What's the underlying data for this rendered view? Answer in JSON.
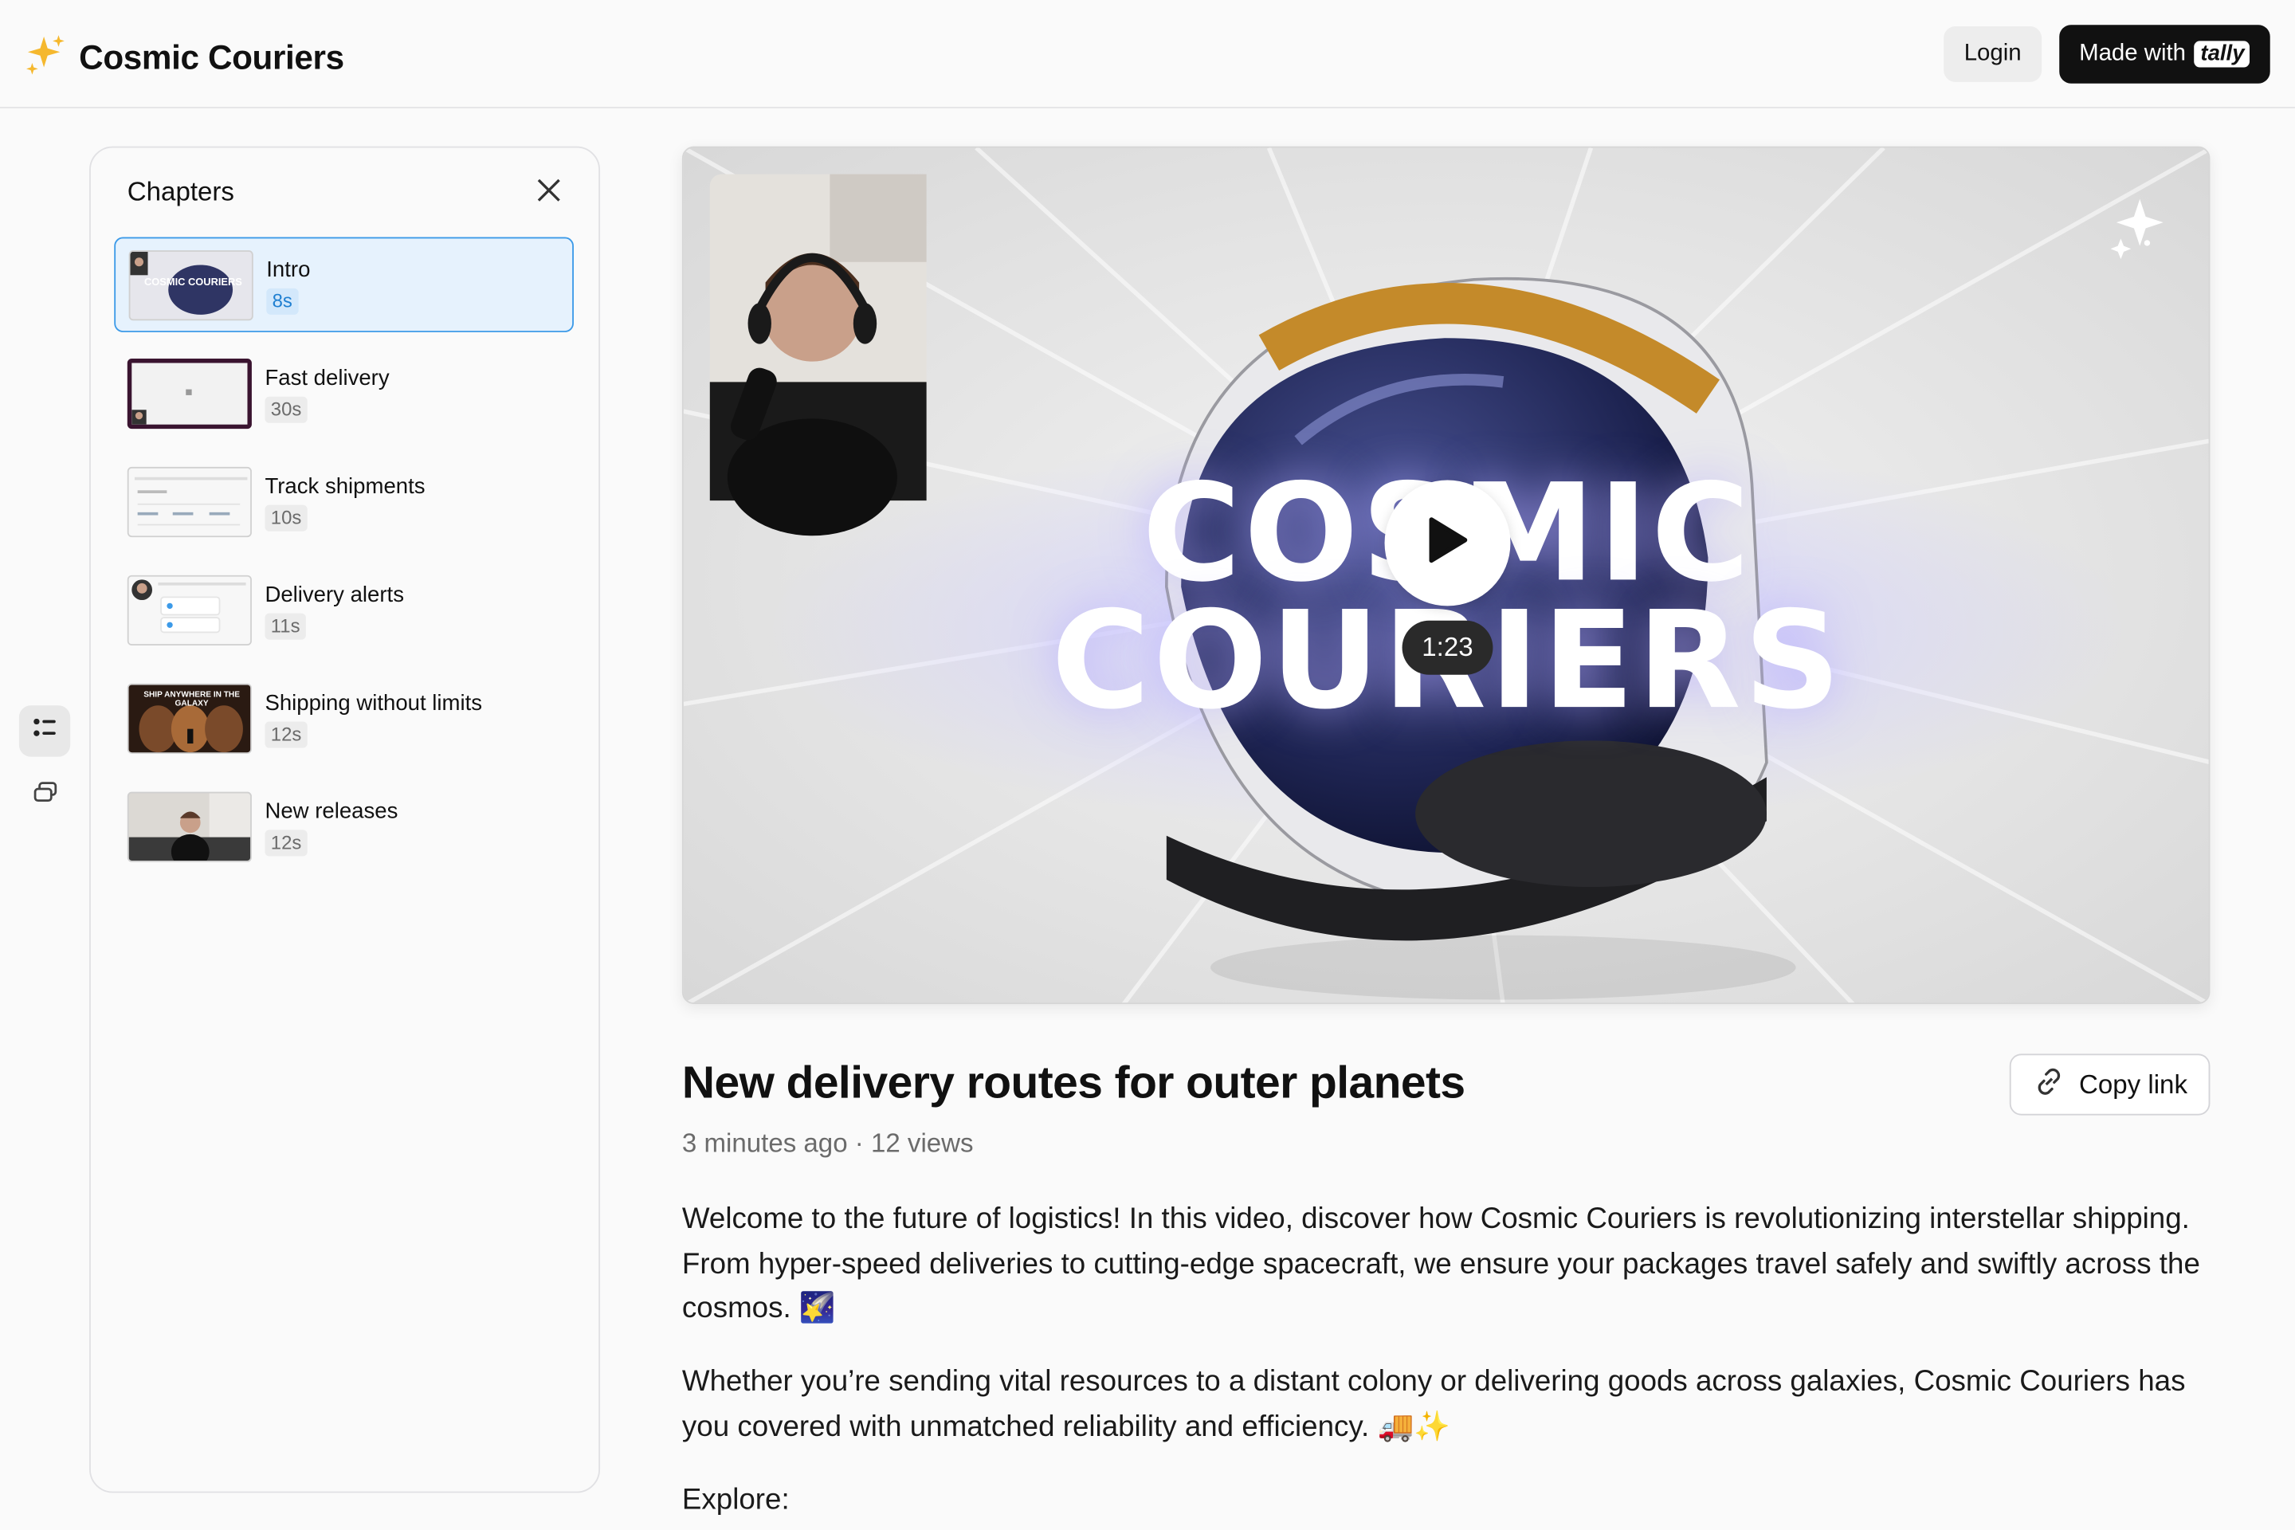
{
  "header": {
    "brand_name": "Cosmic Couriers",
    "brand_icon": "sparkles-icon",
    "login_label": "Login",
    "made_with_label": "Made with",
    "made_with_brand": "tally"
  },
  "rail": {
    "items": [
      {
        "icon": "list-icon",
        "active": true
      },
      {
        "icon": "comments-icon",
        "active": false
      }
    ]
  },
  "chapters": {
    "title": "Chapters",
    "items": [
      {
        "title": "Intro",
        "duration": "8s",
        "active": true,
        "thumb_text": "COSMIC COURIERS"
      },
      {
        "title": "Fast delivery",
        "duration": "30s",
        "active": false
      },
      {
        "title": "Track shipments",
        "duration": "10s",
        "active": false
      },
      {
        "title": "Delivery alerts",
        "duration": "11s",
        "active": false
      },
      {
        "title": "Shipping without limits",
        "duration": "12s",
        "active": false,
        "thumb_text": "SHIP ANYWHERE IN THE GALAXY"
      },
      {
        "title": "New releases",
        "duration": "12s",
        "active": false
      }
    ]
  },
  "video": {
    "title_line1": "COSMIC",
    "title_line2": "COURIERS",
    "duration": "1:23"
  },
  "info": {
    "title": "New delivery routes for outer planets",
    "copy_link_label": "Copy link",
    "meta": "3 minutes ago · 12 views",
    "paragraphs": [
      "Welcome to the future of logistics! In this video, discover how Cosmic Couriers is revolutionizing interstellar shipping. From hyper-speed deliveries to cutting-edge spacecraft, we ensure your packages travel safely and swiftly across the cosmos. 🌠",
      "Whether you’re sending vital resources to a distant colony or delivering goods across galaxies, Cosmic Couriers has you covered with unmatched reliability and efficiency. 🚚✨",
      "Explore:"
    ]
  },
  "colors": {
    "accent": "#3c9ae8",
    "active_bg": "#e6f2fd",
    "dark_button": "#111111",
    "brand_star": "#f5b82e"
  }
}
